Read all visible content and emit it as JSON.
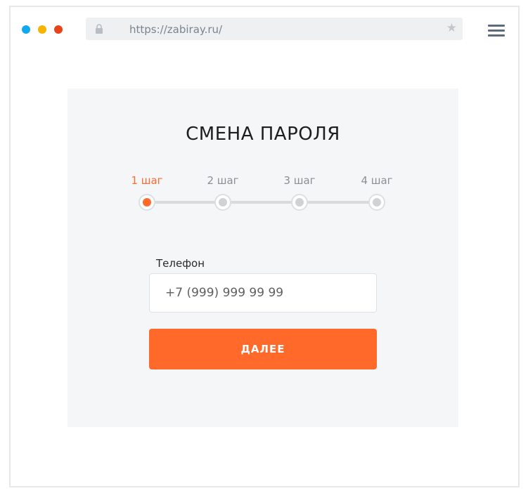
{
  "browser": {
    "url": "https://zabiray.ru/",
    "icons": {
      "lock": "lock-icon",
      "star": "star-icon",
      "menu": "hamburger-menu-icon"
    },
    "dot_colors": [
      "#11a9ee",
      "#f6b400",
      "#e8441c"
    ]
  },
  "form": {
    "title": "СМЕНА ПАРОЛЯ",
    "steps": [
      {
        "label": "1 шаг",
        "active": true
      },
      {
        "label": "2 шаг",
        "active": false
      },
      {
        "label": "3 шаг",
        "active": false
      },
      {
        "label": "4 шаг",
        "active": false
      }
    ],
    "phone_label": "Телефон",
    "phone_placeholder": "+7 (999) 999 99 99",
    "next_label": "ДАЛЕЕ"
  },
  "colors": {
    "accent": "#ff6a2b",
    "card_bg": "#f5f6f8",
    "step_inactive": "#d0d2d5"
  }
}
